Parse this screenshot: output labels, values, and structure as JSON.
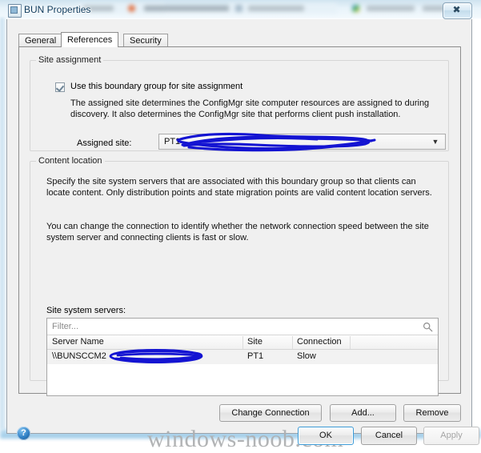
{
  "window": {
    "title": "BUN Properties",
    "icon": "properties-window-icon",
    "close_label": "✖"
  },
  "tabs": [
    {
      "label": "General",
      "active": false
    },
    {
      "label": "References",
      "active": true
    },
    {
      "label": "Security",
      "active": false
    }
  ],
  "site_assignment": {
    "group_caption": "Site assignment",
    "checkbox_label": "Use this boundary group for site assignment",
    "checkbox_checked": true,
    "description": "The assigned site determines the ConfigMgr site computer resources are assigned to during discovery. It also determines the ConfigMgr site that performs client push installation.",
    "assigned_site_label": "Assigned site:",
    "assigned_site_value": "PT1-",
    "assigned_site_redacted": true,
    "dropdown_arrow": "▼"
  },
  "content_location": {
    "group_caption": "Content location",
    "paragraph_1": "Specify the site system servers that are associated with this boundary group so that clients can locate content. Only distribution points and state migration points are valid content location servers.",
    "paragraph_2": "You can change the connection to identify whether the network connection speed between the site system server and connecting clients is fast or slow.",
    "list_label": "Site system servers:",
    "filter_placeholder": "Filter...",
    "search_icon": "search-icon",
    "columns": [
      "Server Name",
      "Site",
      "Connection",
      ""
    ],
    "rows": [
      {
        "server_name": "\\\\BUNSCCM2",
        "redacted": true,
        "site": "PT1",
        "connection": "Slow"
      }
    ],
    "buttons": {
      "change_connection": "Change Connection",
      "add": "Add...",
      "remove": "Remove"
    }
  },
  "footer": {
    "help_icon": "help-icon",
    "help_glyph": "?",
    "ok": "OK",
    "cancel": "Cancel",
    "apply": "Apply",
    "apply_disabled": true,
    "watermark": "windows-noob.com"
  },
  "colors": {
    "redaction": "#1414d2",
    "dialog_bg": "#f0f0f0",
    "accent_focus": "#3c9ad6",
    "title_text": "#0d3a5c"
  }
}
